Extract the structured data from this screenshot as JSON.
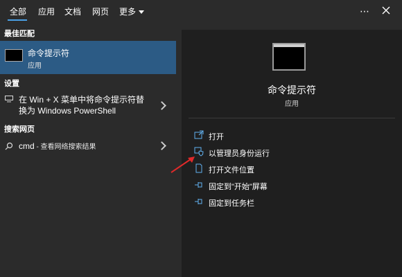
{
  "tabs": [
    "全部",
    "应用",
    "文档",
    "网页",
    "更多"
  ],
  "left": {
    "best_match_label": "最佳匹配",
    "best_match": {
      "title": "命令提示符",
      "subtitle": "应用"
    },
    "settings_label": "设置",
    "settings_item": {
      "line1": "在 Win + X 菜单中将命令提示符替",
      "line2": "换为 Windows PowerShell"
    },
    "web_label": "搜索网页",
    "web_item": {
      "query": "cmd",
      "suffix": " - 查看网络搜索结果"
    }
  },
  "right": {
    "app_title": "命令提示符",
    "app_subtitle": "应用",
    "actions": [
      "打开",
      "以管理员身份运行",
      "打开文件位置",
      "固定到\"开始\"屏幕",
      "固定到任务栏"
    ]
  },
  "colors": {
    "selected": "#2c5b85",
    "accent": "#4aa0e6",
    "arrow": "#e02a2a",
    "icon": "#62b2f0"
  }
}
